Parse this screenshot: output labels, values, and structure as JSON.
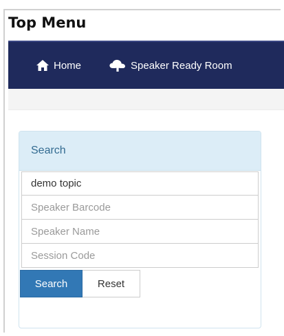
{
  "page_label": "Top Menu",
  "navbar": {
    "items": [
      {
        "label": "Home",
        "icon": "home-icon"
      },
      {
        "label": "Speaker Ready Room",
        "icon": "cloud-upload-icon"
      }
    ],
    "background": "#1f2a5c"
  },
  "search_panel": {
    "heading": "Search",
    "fields": [
      {
        "value": "demo topic",
        "placeholder": ""
      },
      {
        "value": "",
        "placeholder": "Speaker Barcode"
      },
      {
        "value": "",
        "placeholder": "Speaker Name"
      },
      {
        "value": "",
        "placeholder": "Session Code"
      }
    ],
    "buttons": {
      "search_label": "Search",
      "reset_label": "Reset"
    },
    "colors": {
      "heading_bg": "#dcedf7",
      "primary": "#3278b5"
    }
  }
}
